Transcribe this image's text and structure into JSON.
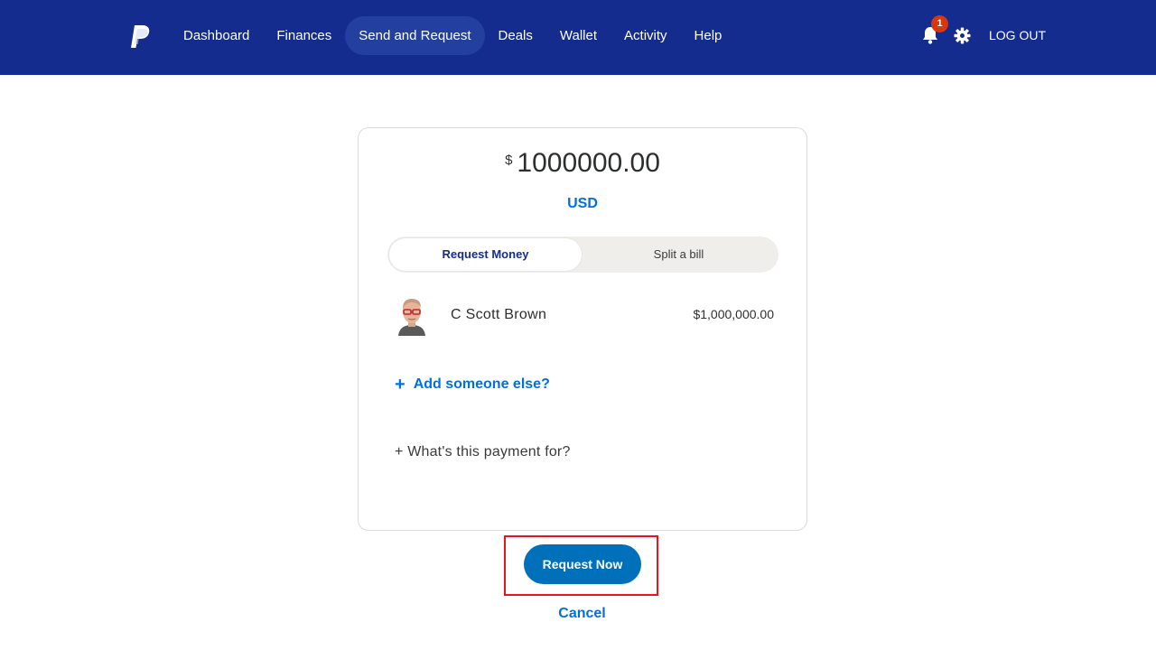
{
  "header": {
    "nav": [
      {
        "label": "Dashboard",
        "active": false
      },
      {
        "label": "Finances",
        "active": false
      },
      {
        "label": "Send and Request",
        "active": true
      },
      {
        "label": "Deals",
        "active": false
      },
      {
        "label": "Wallet",
        "active": false
      },
      {
        "label": "Activity",
        "active": false
      },
      {
        "label": "Help",
        "active": false
      }
    ],
    "notification_count": "1",
    "logout_label": "LOG OUT",
    "icons": {
      "logo": "paypal-logo",
      "bell": "bell-icon",
      "settings": "gear-icon"
    }
  },
  "request": {
    "currency_symbol": "$",
    "amount": "1000000.00",
    "currency_code": "USD",
    "tabs": [
      {
        "label": "Request Money",
        "selected": true
      },
      {
        "label": "Split a bill",
        "selected": false
      }
    ],
    "recipient": {
      "name": "C Scott Brown",
      "amount": "$1,000,000.00"
    },
    "add_someone_label": "Add someone else?",
    "add_icon": "+",
    "payment_for_label": "+ What's this payment for?"
  },
  "actions": {
    "request_now_label": "Request Now",
    "cancel_label": "Cancel"
  },
  "colors": {
    "header_bg": "#142c8e",
    "link_blue": "#0070e0",
    "button_blue": "#0070ba",
    "badge_red": "#d9360b",
    "highlight_red": "#e8141c"
  }
}
